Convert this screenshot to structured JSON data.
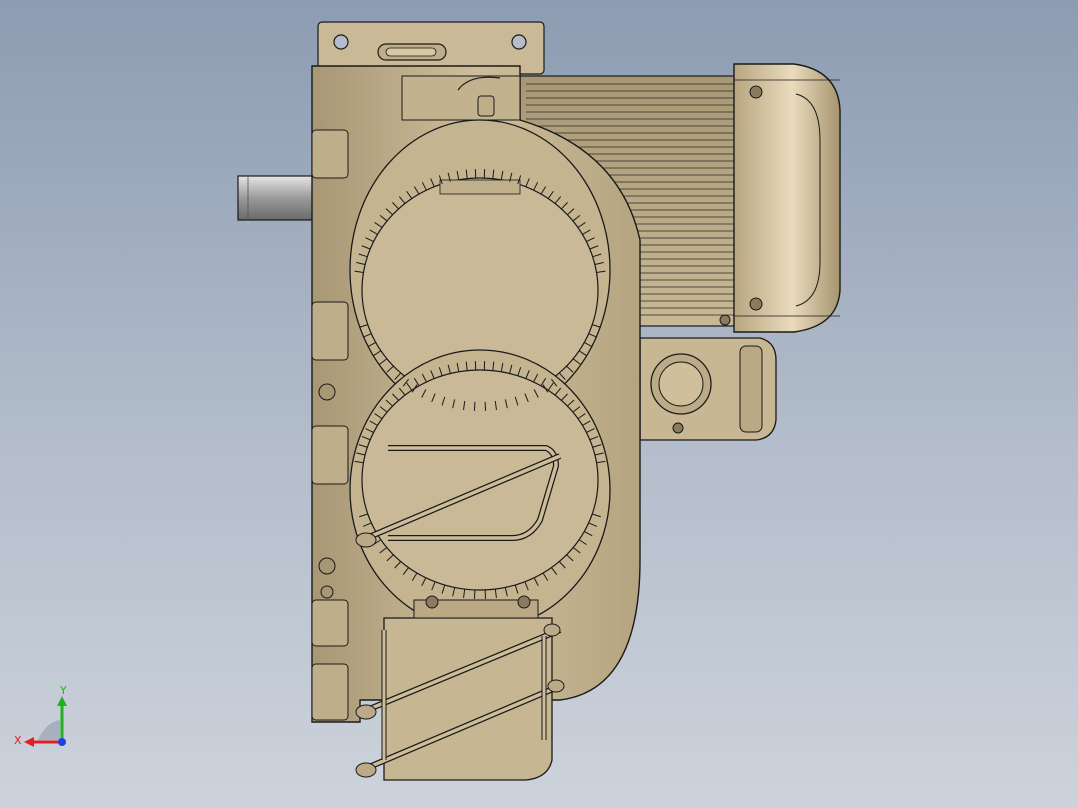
{
  "viewport": {
    "background_top": "#8d9cb2",
    "background_bottom": "#cdd3dc"
  },
  "model": {
    "body_color": "#c9b996",
    "body_shadow_color": "#9c8c6c",
    "edge_color": "#1a1a1a",
    "shaft_color": "#b0b0b0",
    "motor_fin_color": "#b9a985",
    "end_cap_color": "#d8c7a2"
  },
  "triad": {
    "x_label": "X",
    "y_label": "Y",
    "x_color": "#e02020",
    "y_color": "#20b020",
    "z_color": "#2040e0"
  }
}
